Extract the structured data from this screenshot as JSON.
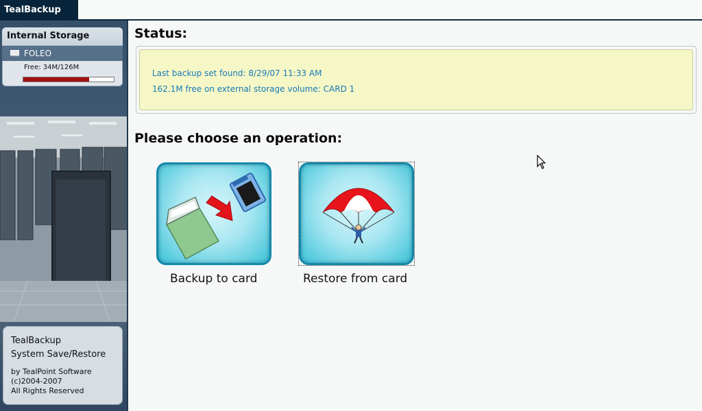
{
  "app": {
    "title": "TealBackup"
  },
  "sidebar": {
    "storage_header": "Internal Storage",
    "device": {
      "name": "FOLEO",
      "icon": "drive-icon"
    },
    "free_text": "Free: 34M/126M",
    "usage": {
      "used_fraction": 0.73,
      "color": "#a30f10"
    },
    "about": {
      "line1": "TealBackup",
      "line2": "System Save/Restore",
      "line3": "by TealPoint Software",
      "line4": "(c)2004-2007",
      "line5": "All Rights Reserved"
    }
  },
  "main": {
    "status_heading": "Status:",
    "status_lines": [
      "Last backup set found: 8/29/07 11:33 AM",
      "162.1M  free on external storage volume: CARD 1"
    ],
    "operation_heading": "Please choose an operation:",
    "operations": [
      {
        "label": "Backup to card",
        "icon": "backup-to-card-icon"
      },
      {
        "label": "Restore from card",
        "icon": "parachute-icon"
      }
    ]
  },
  "colors": {
    "accent": "#08243a",
    "status_text": "#1579b8",
    "status_bg": "#f6f7c6"
  }
}
